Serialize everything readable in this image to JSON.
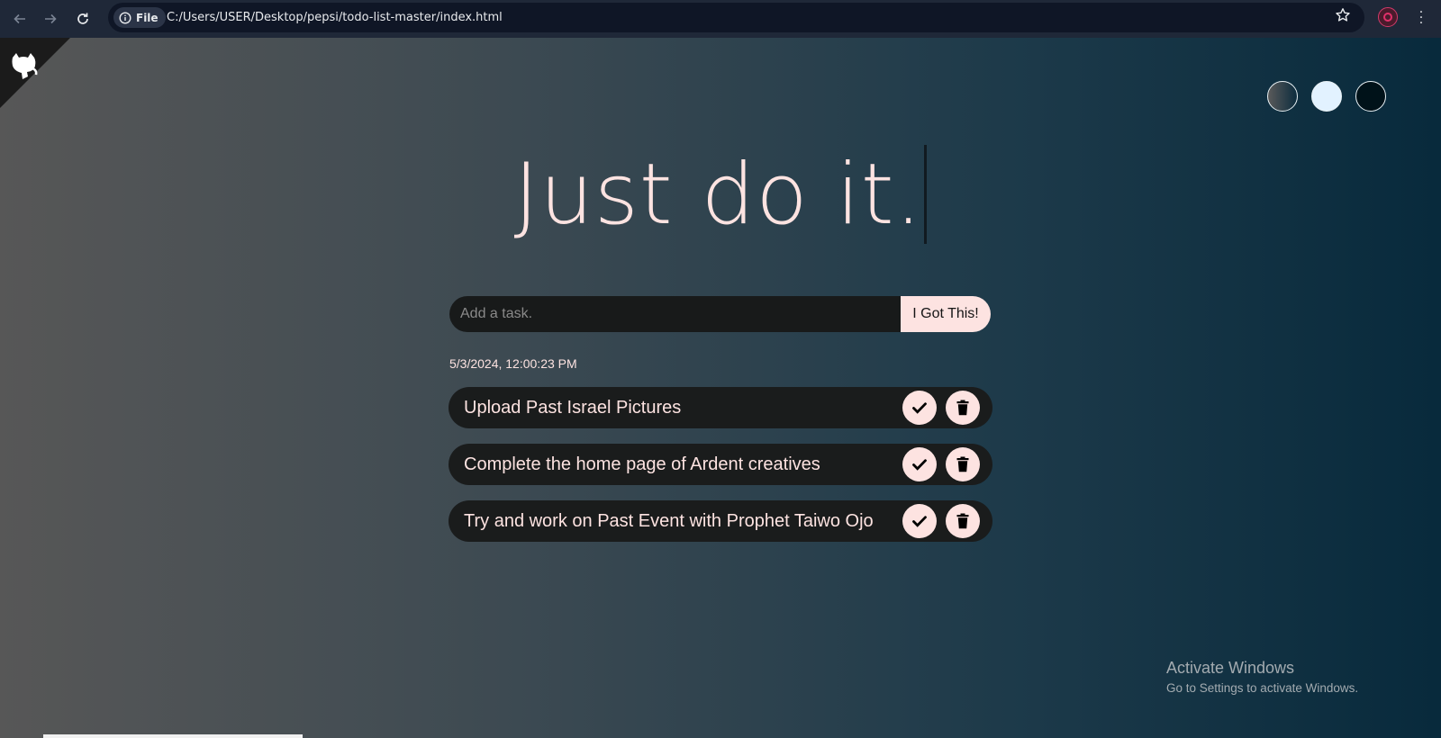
{
  "browser": {
    "file_chip": "File",
    "url": "C:/Users/USER/Desktop/pepsi/todo-list-master/index.html"
  },
  "page": {
    "title": "Just do it.",
    "input_placeholder": "Add a task.",
    "add_button": "I Got This!",
    "datetime": "5/3/2024, 12:00:23 PM",
    "themes": [
      "standard",
      "light",
      "darker"
    ],
    "todos": [
      {
        "text": "Upload Past Israel Pictures"
      },
      {
        "text": "Complete the home page of Ardent creatives"
      },
      {
        "text": "Try and work on Past Event with Prophet Taiwo Ojo"
      }
    ]
  },
  "watermark": {
    "title": "Activate Windows",
    "subtitle": "Go to Settings to activate Windows."
  },
  "colors": {
    "accent": "#fde3e1",
    "item_bg": "#1a1c1c"
  }
}
